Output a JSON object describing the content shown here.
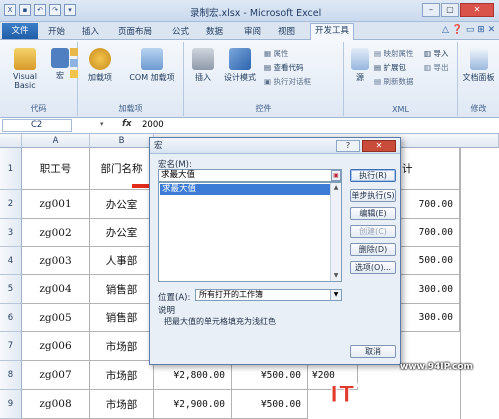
{
  "title": "录制宏.xlsx - Microsoft Excel",
  "tabs": [
    "文件",
    "开始",
    "插入",
    "页面布局",
    "公式",
    "数据",
    "审阅",
    "视图",
    "开发工具"
  ],
  "active_tab": "开发工具",
  "ribbon": {
    "code": {
      "visual_basic": "Visual Basic",
      "macro": "宏",
      "label": "代码"
    },
    "addins": {
      "addins": "加载项",
      "com_addins": "COM 加载项",
      "label": "加载项"
    },
    "controls": {
      "insert": "插入",
      "design_mode": "设计模式",
      "properties": "属性",
      "view_code": "查看代码",
      "run_dialog": "执行对话框",
      "label": "控件"
    },
    "xml": {
      "source": "源",
      "map_properties": "映射属性",
      "expansion_packs": "扩展包",
      "refresh_data": "刷新数据",
      "import": "导入",
      "export": "导出",
      "label": "XML"
    },
    "modify": {
      "document_panel": "文档面板",
      "label": "修改"
    }
  },
  "formula_bar": {
    "name_box": "C2",
    "fx": "fx",
    "value": "2000"
  },
  "columns": [
    "A",
    "B"
  ],
  "rows": [
    {
      "num": "1",
      "a": "职工号",
      "b": "部门名称"
    },
    {
      "num": "2",
      "a": "zg001",
      "b": "办公室"
    },
    {
      "num": "3",
      "a": "zg002",
      "b": "办公室"
    },
    {
      "num": "4",
      "a": "zg003",
      "b": "人事部"
    },
    {
      "num": "5",
      "a": "zg004",
      "b": "销售部"
    },
    {
      "num": "6",
      "a": "zg005",
      "b": "销售部"
    },
    {
      "num": "7",
      "a": "zg006",
      "b": "市场部"
    },
    {
      "num": "8",
      "a": "zg007",
      "b": "市场部",
      "c": "¥2,800.00",
      "d": "¥500.00",
      "e": "¥200"
    },
    {
      "num": "9",
      "a": "zg008",
      "b": "市场部",
      "c": "¥2,900.00",
      "d": "¥500.00"
    }
  ],
  "right_col": {
    "header": "计",
    "values": [
      "700.00",
      "700.00",
      "500.00",
      "300.00",
      "300.00"
    ]
  },
  "dialog": {
    "title": "宏",
    "help": "?",
    "macro_name_label": "宏名(M):",
    "macro_name_value": "求最大值",
    "macro_list": [
      "求最大值"
    ],
    "buttons": [
      "执行(R)",
      "单步执行(S)",
      "编辑(E)",
      "创建(C)",
      "删除(D)",
      "选项(O)..."
    ],
    "cancel": "取消",
    "location_label": "位置(A):",
    "location_value": "所有打开的工作簿",
    "description_label": "说明",
    "description_text": "把最大值的单元格填充为浅红色"
  },
  "watermark": {
    "url": "www.94IP.com",
    "brand": "IT运维空间"
  }
}
